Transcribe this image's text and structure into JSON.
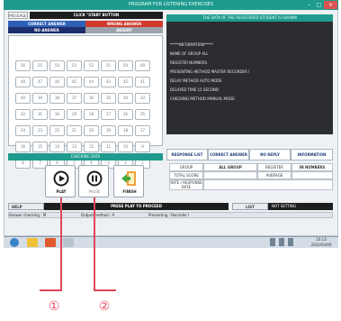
{
  "window": {
    "title": "PROGRAM FOR LISTENING EXERCISES",
    "controls": [
      "–",
      "□",
      "×"
    ]
  },
  "top": {
    "message_label": "MESSAGE",
    "click_start": "CLICK \"START BUTTON"
  },
  "answer_box": {
    "correct": "CORRECT ANSWER",
    "wrong": "WRONG ANSWER",
    "no_answer": "NO ANSWER",
    "absent": "ABSENT"
  },
  "grid": {
    "rows": [
      [
        "56",
        "55",
        "54",
        "53",
        "52",
        "51",
        "50",
        "49"
      ],
      [
        "48",
        "47",
        "46",
        "45",
        "44",
        "43",
        "42",
        "41"
      ],
      [
        "40",
        "39",
        "38",
        "37",
        "36",
        "35",
        "34",
        "33"
      ],
      [
        "32",
        "31",
        "30",
        "29",
        "28",
        "27",
        "26",
        "25"
      ],
      [
        "24",
        "23",
        "22",
        "21",
        "20",
        "19",
        "18",
        "17"
      ],
      [
        "16",
        "15",
        "14",
        "13",
        "12",
        "11",
        "10",
        "9"
      ],
      [
        "8",
        "7",
        "6",
        "5",
        "4",
        "3",
        "2",
        "1"
      ]
    ]
  },
  "teacher": {
    "heading": "THE DATA OF THE REGISTERED STUDENT IS SHOWN",
    "lines": [
      "*****INFORMATION*****",
      "NAME OF GROUP    ALL",
      "REGISTER    NUMBERS",
      "PRESENTING METHOD  MASTER RECORDER I",
      "DELAY METHOD    AUTO MODE",
      "DELAYED TIME    15 SECOND",
      "CHECKING METHOD    MANUAL MODE"
    ]
  },
  "center": {
    "caption": "CHECKING DATA"
  },
  "tabs": [
    "RESPONSE LIST",
    "CORRECT ANSWER",
    "NO REPLY",
    "INFORMATION"
  ],
  "stats": {
    "group_label": "GROUP",
    "group_value": "ALL GROUP",
    "register_label": "REGISTER",
    "register_value": "IN NUMBERS",
    "total_label": "TOTAL SCORE",
    "average_label": "AVERAGE",
    "rate_label": "RATE / RESPONSE RATE"
  },
  "controls": {
    "play": "PLAY",
    "pause": "PAUSE",
    "finish": "FINISH"
  },
  "status": {
    "help": "HELP",
    "message": "PRESS PLAY TO PROCEED",
    "list": "LIST",
    "setting": "NOT SETTING",
    "answer_checking": "Answer checking : M",
    "output_method": "Output method : A",
    "presenting": "Presenting : Recorder I"
  },
  "taskbar": {
    "clock_time": "10:13",
    "clock_date": "2020/04/09"
  },
  "callouts": [
    "①",
    "②"
  ],
  "colors": {
    "title_teal": "#1f9b8e",
    "correct_blue": "#2d5fb5",
    "wrong_red": "#d03a2c",
    "no_answer_navy": "#1d2e6e",
    "absent_gray": "#9aa3ab",
    "info_dark": "#2b2d31",
    "callout_pink": "#e0465a"
  }
}
